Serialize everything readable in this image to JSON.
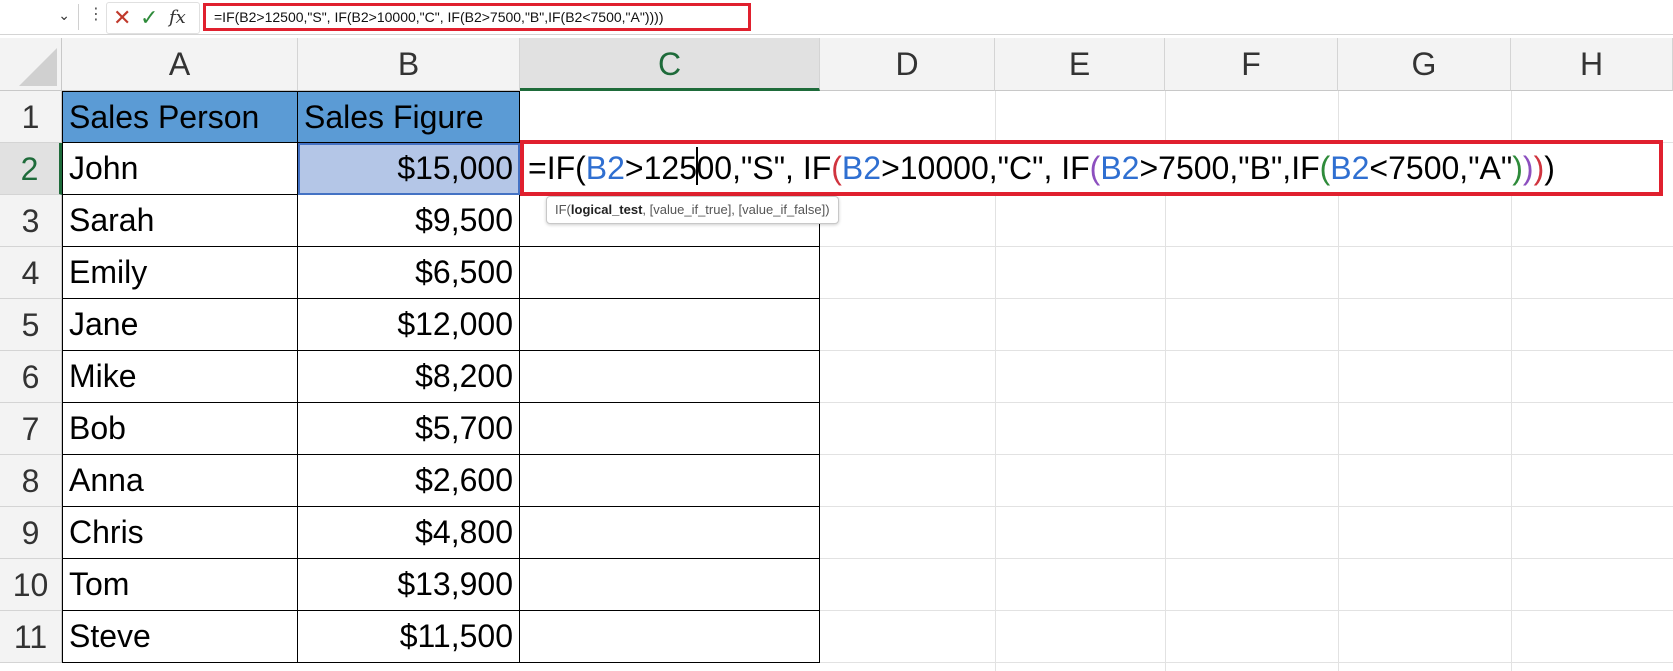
{
  "formula_bar": {
    "name_box_value": "",
    "cancel_icon": "x-icon",
    "enter_icon": "check-icon",
    "fx_label": "fx",
    "formula": "=IF(B2>12500,\"S\", IF(B2>10000,\"C\", IF(B2>7500,\"B\",IF(B2<7500,\"A\"))))",
    "highlight_color": "#e0202e"
  },
  "columns": [
    "A",
    "B",
    "C",
    "D",
    "E",
    "F",
    "G",
    "H"
  ],
  "rows": [
    "1",
    "2",
    "3",
    "4",
    "5",
    "6",
    "7",
    "8",
    "9",
    "10",
    "11"
  ],
  "table": {
    "headers": [
      "Sales Person",
      "Sales Figure"
    ],
    "rows": [
      {
        "name": "John",
        "sales": "$15,000"
      },
      {
        "name": "Sarah",
        "sales": "$9,500"
      },
      {
        "name": "Emily",
        "sales": "$6,500"
      },
      {
        "name": "Jane",
        "sales": "$12,000"
      },
      {
        "name": "Mike",
        "sales": "$8,200"
      },
      {
        "name": "Bob",
        "sales": "$5,700"
      },
      {
        "name": "Anna",
        "sales": "$2,600"
      },
      {
        "name": "Chris",
        "sales": "$4,800"
      },
      {
        "name": "Tom",
        "sales": "$13,900"
      },
      {
        "name": "Steve",
        "sales": "$11,500"
      }
    ],
    "header_fill": "#5b9bd5"
  },
  "cell_edit": {
    "parts": [
      "=IF(",
      "B2",
      ">125",
      "00,\"S\", IF",
      "(",
      "B2",
      ">10000,\"C\", IF",
      "(",
      "B2",
      ">7500,\"B\",IF",
      "(",
      "B2",
      "<7500,\"A\"",
      ")",
      ")",
      ")",
      ")"
    ]
  },
  "tooltip": {
    "prefix": "IF(",
    "bold": "logical_test",
    "rest": ", [value_if_true], [value_if_false])"
  }
}
